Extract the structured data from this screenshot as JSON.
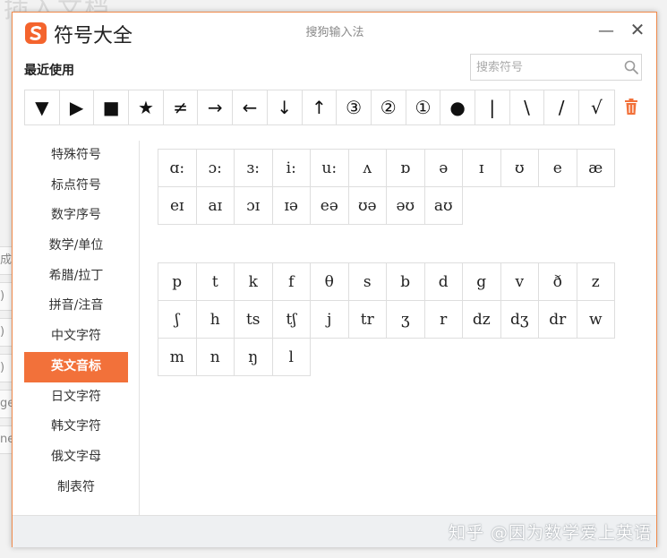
{
  "window": {
    "title": "符号大全",
    "subtitle": "搜狗输入法",
    "minimize": "—",
    "close": "✕",
    "brand_color": "#f4642d",
    "accent_color": "#f2713a"
  },
  "recent": {
    "label": "最近使用",
    "search_placeholder": "搜索符号",
    "symbols": [
      "▼",
      "▶",
      "■",
      "★",
      "≠",
      "→",
      "←",
      "↓",
      "↑",
      "③",
      "②",
      "①",
      "●",
      "|",
      "\\",
      "/",
      "√"
    ]
  },
  "categories": [
    {
      "label": "特殊符号",
      "active": false
    },
    {
      "label": "标点符号",
      "active": false
    },
    {
      "label": "数字序号",
      "active": false
    },
    {
      "label": "数学/单位",
      "active": false
    },
    {
      "label": "希腊/拉丁",
      "active": false
    },
    {
      "label": "拼音/注音",
      "active": false
    },
    {
      "label": "中文字符",
      "active": false
    },
    {
      "label": "英文音标",
      "active": true
    },
    {
      "label": "日文字符",
      "active": false
    },
    {
      "label": "韩文字符",
      "active": false
    },
    {
      "label": "俄文字母",
      "active": false
    },
    {
      "label": "制表符",
      "active": false
    }
  ],
  "vowels": [
    "ɑ:",
    "ɔ:",
    "ɜ:",
    "i:",
    "u:",
    "ʌ",
    "ɒ",
    "ə",
    "ɪ",
    "ʊ",
    "e",
    "æ",
    "eɪ",
    "aɪ",
    "ɔɪ",
    "ɪə",
    "eə",
    "ʊə",
    "əʊ",
    "aʊ"
  ],
  "consonants": [
    "p",
    "t",
    "k",
    "f",
    "θ",
    "s",
    "b",
    "d",
    "g",
    "v",
    "ð",
    "z",
    "ʃ",
    "h",
    "ts",
    "tʃ",
    "j",
    "tr",
    "ʒ",
    "r",
    "dz",
    "dʒ",
    "dr",
    "w",
    "m",
    "n",
    "ŋ",
    "l"
  ],
  "background": {
    "title": "插入文档",
    "side_labels": [
      "成",
      ")",
      ")",
      ")",
      "ge",
      "ne"
    ]
  },
  "footer": {
    "watermark": "知乎 @因为数学爱上英语"
  }
}
